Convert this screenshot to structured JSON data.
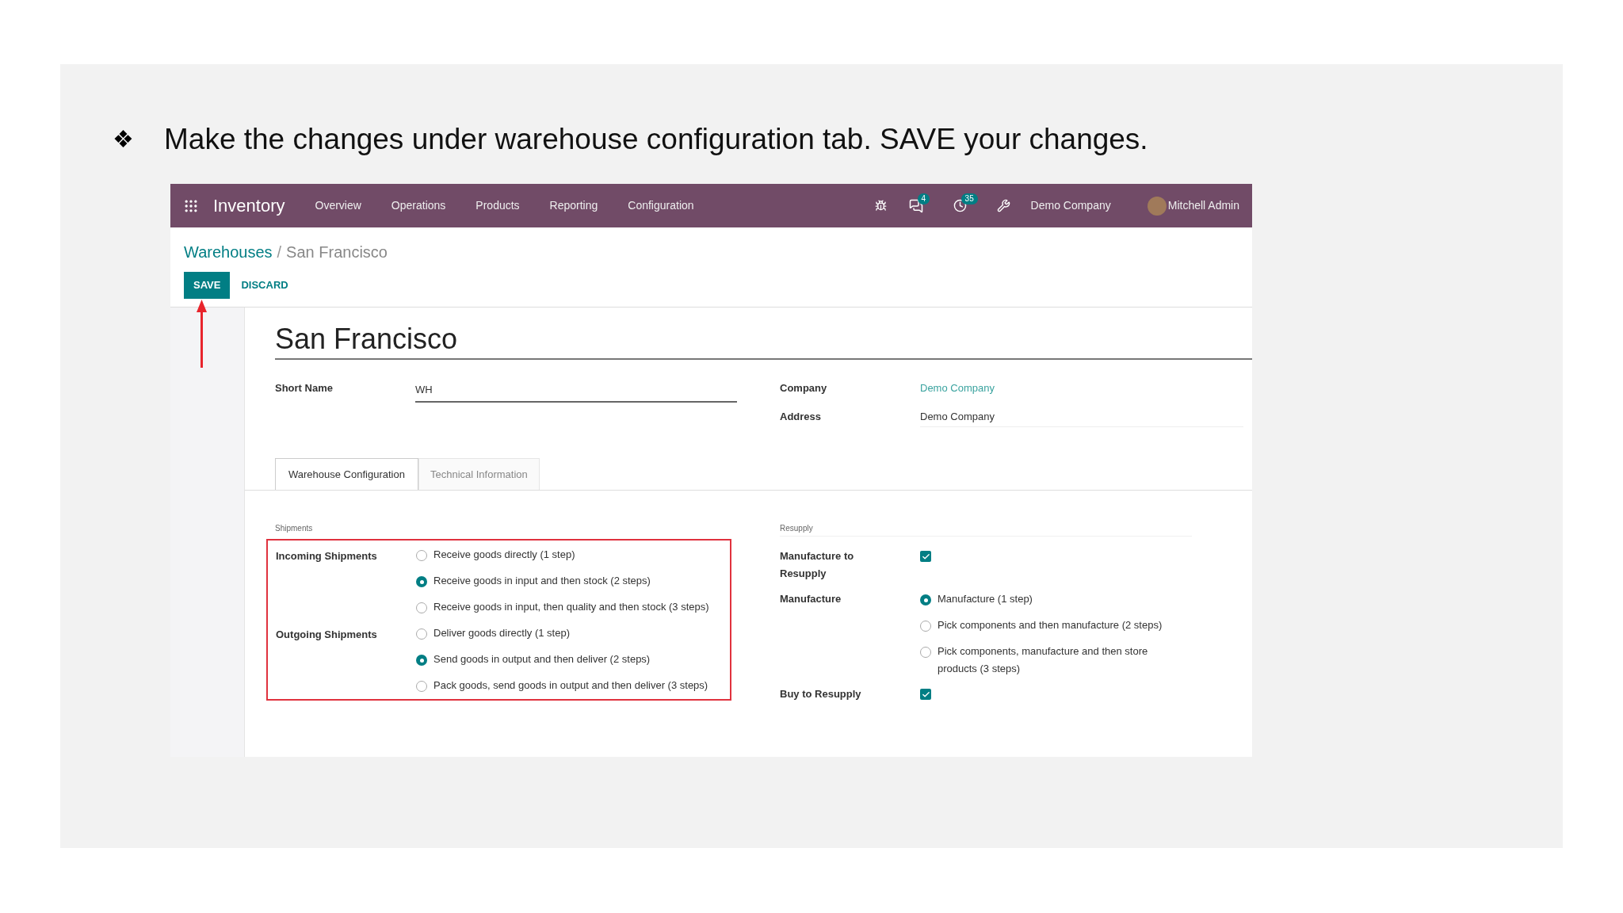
{
  "slide": {
    "bullet": "❖",
    "instruction": "Make the changes under warehouse configuration tab. SAVE your changes."
  },
  "navbar": {
    "app_name": "Inventory",
    "menu": [
      "Overview",
      "Operations",
      "Products",
      "Reporting",
      "Configuration"
    ],
    "chat_badge": "4",
    "activity_badge": "35",
    "company": "Demo Company",
    "user": "Mitchell Admin"
  },
  "breadcrumb": {
    "parent": "Warehouses",
    "separator": "/",
    "current": "San Francisco"
  },
  "buttons": [
    {
      "label": "SAVE",
      "kind": "primary"
    },
    {
      "label": "DISCARD",
      "kind": "link"
    }
  ],
  "form": {
    "title": "San Francisco",
    "short_name": {
      "label": "Short Name",
      "value": "WH"
    },
    "company": {
      "label": "Company",
      "value": "Demo Company"
    },
    "address": {
      "label": "Address",
      "value": "Demo Company"
    }
  },
  "tabs": [
    {
      "label": "Warehouse Configuration",
      "selected": true
    },
    {
      "label": "Technical Information",
      "selected": false
    }
  ],
  "shipments": {
    "heading": "Shipments",
    "groups": [
      {
        "label": "Incoming Shipments",
        "options": [
          {
            "label": "Receive goods directly (1 step)",
            "selected": false
          },
          {
            "label": "Receive goods in input and then stock (2 steps)",
            "selected": true
          },
          {
            "label": "Receive goods in input, then quality and then stock (3 steps)",
            "selected": false
          }
        ]
      },
      {
        "label": "Outgoing Shipments",
        "options": [
          {
            "label": "Deliver goods directly (1 step)",
            "selected": false
          },
          {
            "label": "Send goods in output and then deliver (2 steps)",
            "selected": true
          },
          {
            "label": "Pack goods, send goods in output and then deliver (3 steps)",
            "selected": false
          }
        ]
      }
    ]
  },
  "resupply": {
    "heading": "Resupply",
    "rows": [
      {
        "kind": "checkbox",
        "label": "Manufacture to Resupply",
        "checked": true
      },
      {
        "kind": "radio",
        "label": "Manufacture",
        "options": [
          {
            "label": "Manufacture (1 step)",
            "selected": true
          },
          {
            "label": "Pick components and then manufacture (2 steps)",
            "selected": false
          },
          {
            "label": "Pick components, manufacture and then store products (3 steps)",
            "selected": false
          }
        ]
      },
      {
        "kind": "checkbox",
        "label": "Buy to Resupply",
        "checked": true
      }
    ]
  }
}
